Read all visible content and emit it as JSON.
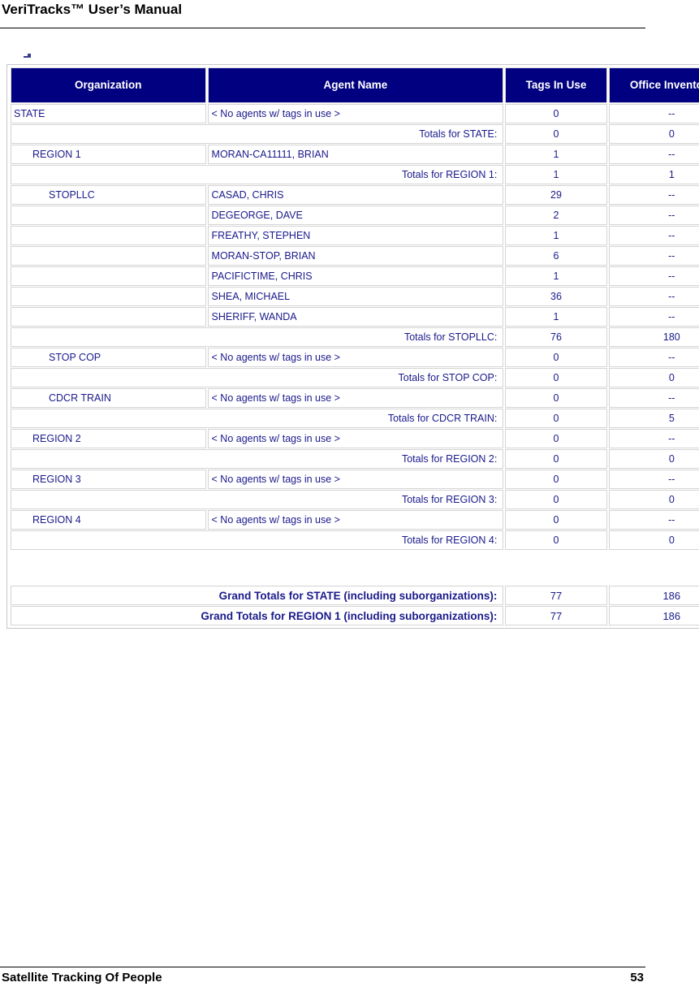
{
  "document": {
    "title": "VeriTracks™ User’s Manual",
    "footer_left": "Satellite Tracking Of People",
    "page_number": "53"
  },
  "colors": {
    "header_bg": "#000080",
    "header_text": "#ffffff",
    "data_text": "#1a1a8c",
    "grid": "#d4d4d4"
  },
  "report": {
    "columns": [
      {
        "key": "organization",
        "label": "Organization"
      },
      {
        "key": "agent_name",
        "label": "Agent Name"
      },
      {
        "key": "tags_in_use",
        "label": "Tags In Use"
      },
      {
        "key": "office_inventory",
        "label": "Office Inventory"
      }
    ],
    "no_agents_text": "< No agents w/ tags in use >",
    "rows": [
      {
        "type": "data",
        "indent": 0,
        "organization": "STATE",
        "agent_name": "< No agents w/ tags in use >",
        "tags_in_use": "0",
        "office_inventory": "--"
      },
      {
        "type": "total",
        "label": "Totals for STATE:",
        "tags_in_use": "0",
        "office_inventory": "0"
      },
      {
        "type": "data",
        "indent": 1,
        "organization": "REGION 1",
        "agent_name": "MORAN-CA11111, BRIAN",
        "tags_in_use": "1",
        "office_inventory": "--"
      },
      {
        "type": "total",
        "label": "Totals for REGION 1:",
        "tags_in_use": "1",
        "office_inventory": "1"
      },
      {
        "type": "data",
        "indent": 2,
        "organization": "STOPLLC",
        "agent_name": "CASAD, CHRIS",
        "tags_in_use": "29",
        "office_inventory": "--"
      },
      {
        "type": "data",
        "indent": 2,
        "organization": "",
        "agent_name": "DEGEORGE, DAVE",
        "tags_in_use": "2",
        "office_inventory": "--"
      },
      {
        "type": "data",
        "indent": 2,
        "organization": "",
        "agent_name": "FREATHY, STEPHEN",
        "tags_in_use": "1",
        "office_inventory": "--"
      },
      {
        "type": "data",
        "indent": 2,
        "organization": "",
        "agent_name": "MORAN-STOP, BRIAN",
        "tags_in_use": "6",
        "office_inventory": "--"
      },
      {
        "type": "data",
        "indent": 2,
        "organization": "",
        "agent_name": "PACIFICTIME, CHRIS",
        "tags_in_use": "1",
        "office_inventory": "--"
      },
      {
        "type": "data",
        "indent": 2,
        "organization": "",
        "agent_name": "SHEA, MICHAEL",
        "tags_in_use": "36",
        "office_inventory": "--"
      },
      {
        "type": "data",
        "indent": 2,
        "organization": "",
        "agent_name": "SHERIFF, WANDA",
        "tags_in_use": "1",
        "office_inventory": "--"
      },
      {
        "type": "total",
        "label": "Totals for STOPLLC:",
        "tags_in_use": "76",
        "office_inventory": "180"
      },
      {
        "type": "data",
        "indent": 2,
        "organization": "STOP COP",
        "agent_name": "< No agents w/ tags in use >",
        "tags_in_use": "0",
        "office_inventory": "--"
      },
      {
        "type": "total",
        "label": "Totals for STOP COP:",
        "tags_in_use": "0",
        "office_inventory": "0"
      },
      {
        "type": "data",
        "indent": 2,
        "organization": "CDCR TRAIN",
        "agent_name": "< No agents w/ tags in use >",
        "tags_in_use": "0",
        "office_inventory": "--"
      },
      {
        "type": "total",
        "label": "Totals for CDCR TRAIN:",
        "tags_in_use": "0",
        "office_inventory": "5"
      },
      {
        "type": "data",
        "indent": 1,
        "organization": "REGION 2",
        "agent_name": "< No agents w/ tags in use >",
        "tags_in_use": "0",
        "office_inventory": "--"
      },
      {
        "type": "total",
        "label": "Totals for REGION 2:",
        "tags_in_use": "0",
        "office_inventory": "0"
      },
      {
        "type": "data",
        "indent": 1,
        "organization": "REGION 3",
        "agent_name": "< No agents w/ tags in use >",
        "tags_in_use": "0",
        "office_inventory": "--"
      },
      {
        "type": "total",
        "label": "Totals for REGION 3:",
        "tags_in_use": "0",
        "office_inventory": "0"
      },
      {
        "type": "data",
        "indent": 1,
        "organization": "REGION 4",
        "agent_name": "< No agents w/ tags in use >",
        "tags_in_use": "0",
        "office_inventory": "--"
      },
      {
        "type": "total",
        "label": "Totals for REGION 4:",
        "tags_in_use": "0",
        "office_inventory": "0"
      },
      {
        "type": "gap"
      },
      {
        "type": "grand",
        "label": "Grand Totals for STATE (including suborganizations):",
        "tags_in_use": "77",
        "office_inventory": "186"
      },
      {
        "type": "grand",
        "label": "Grand Totals for REGION 1 (including suborganizations):",
        "tags_in_use": "77",
        "office_inventory": "186"
      }
    ]
  }
}
